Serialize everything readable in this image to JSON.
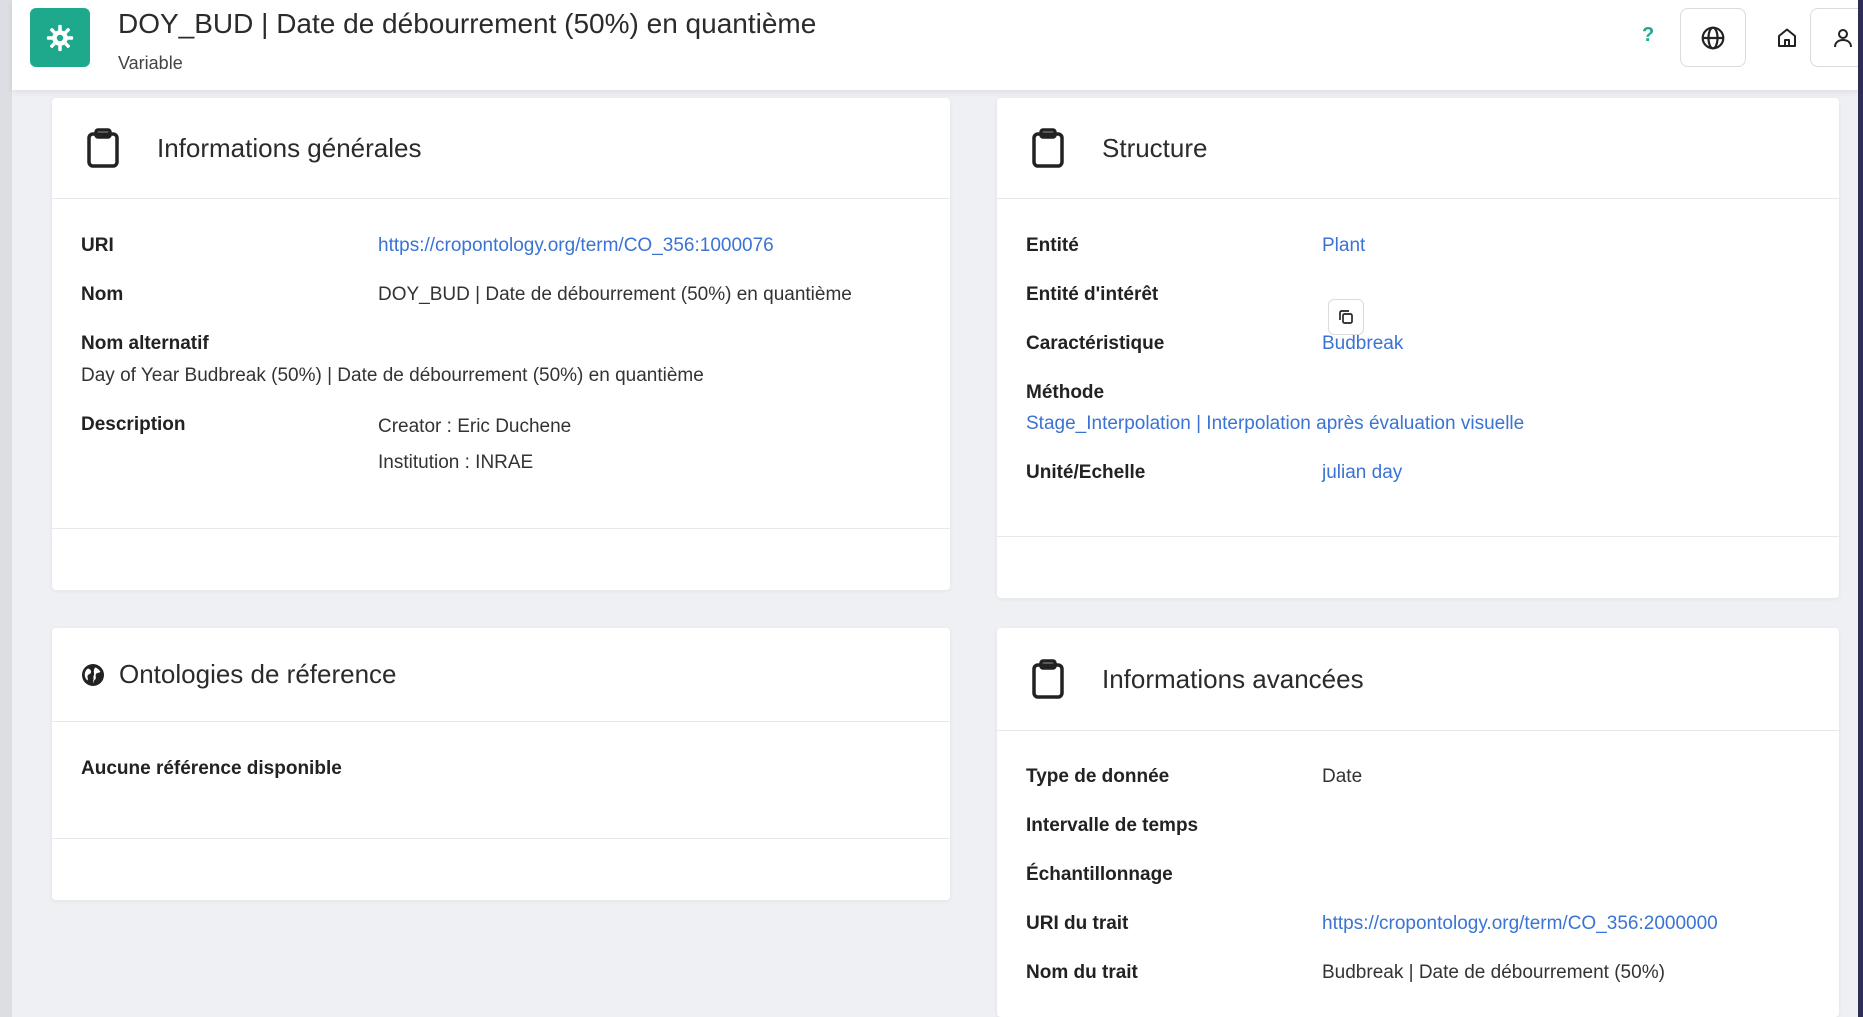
{
  "header": {
    "title": "DOY_BUD | Date de débourrement (50%) en quantième",
    "subtitle": "Variable",
    "help_label": "?",
    "accent_color": "#1ea98d",
    "icons": [
      "gear-icon",
      "globe-icon",
      "home-icon",
      "user-icon"
    ]
  },
  "general_info": {
    "title": "Informations générales",
    "uri_label": "URI",
    "uri_value": "https://cropontology.org/term/CO_356:1000076",
    "name_label": "Nom",
    "name_value": "DOY_BUD | Date de débourrement (50%) en quantième",
    "alt_name_label": "Nom alternatif",
    "alt_name_value": "Day of Year Budbreak (50%) | Date de débourrement (50%) en quantième",
    "description_label": "Description",
    "description_lines": [
      "Creator : Eric Duchene",
      "Institution : INRAE"
    ]
  },
  "structure": {
    "title": "Structure",
    "entity_label": "Entité",
    "entity_value": "Plant",
    "entity_interest_label": "Entité d'intérêt",
    "characteristic_label": "Caractéristique",
    "characteristic_value": "Budbreak",
    "method_label": "Méthode",
    "method_value": "Stage_Interpolation | Interpolation après évaluation visuelle",
    "unit_label": "Unité/Echelle",
    "unit_value": "julian day"
  },
  "ontologies": {
    "title": "Ontologies de réference",
    "empty_message": "Aucune référence disponible"
  },
  "advanced_info": {
    "title": "Informations avancées",
    "data_type_label": "Type de donnée",
    "data_type_value": "Date",
    "time_interval_label": "Intervalle de temps",
    "sampling_label": "Échantillonnage",
    "trait_uri_label": "URI du trait",
    "trait_uri_value": "https://cropontology.org/term/CO_356:2000000",
    "trait_name_label": "Nom du trait",
    "trait_name_value": "Budbreak | Date de débourrement (50%)"
  }
}
